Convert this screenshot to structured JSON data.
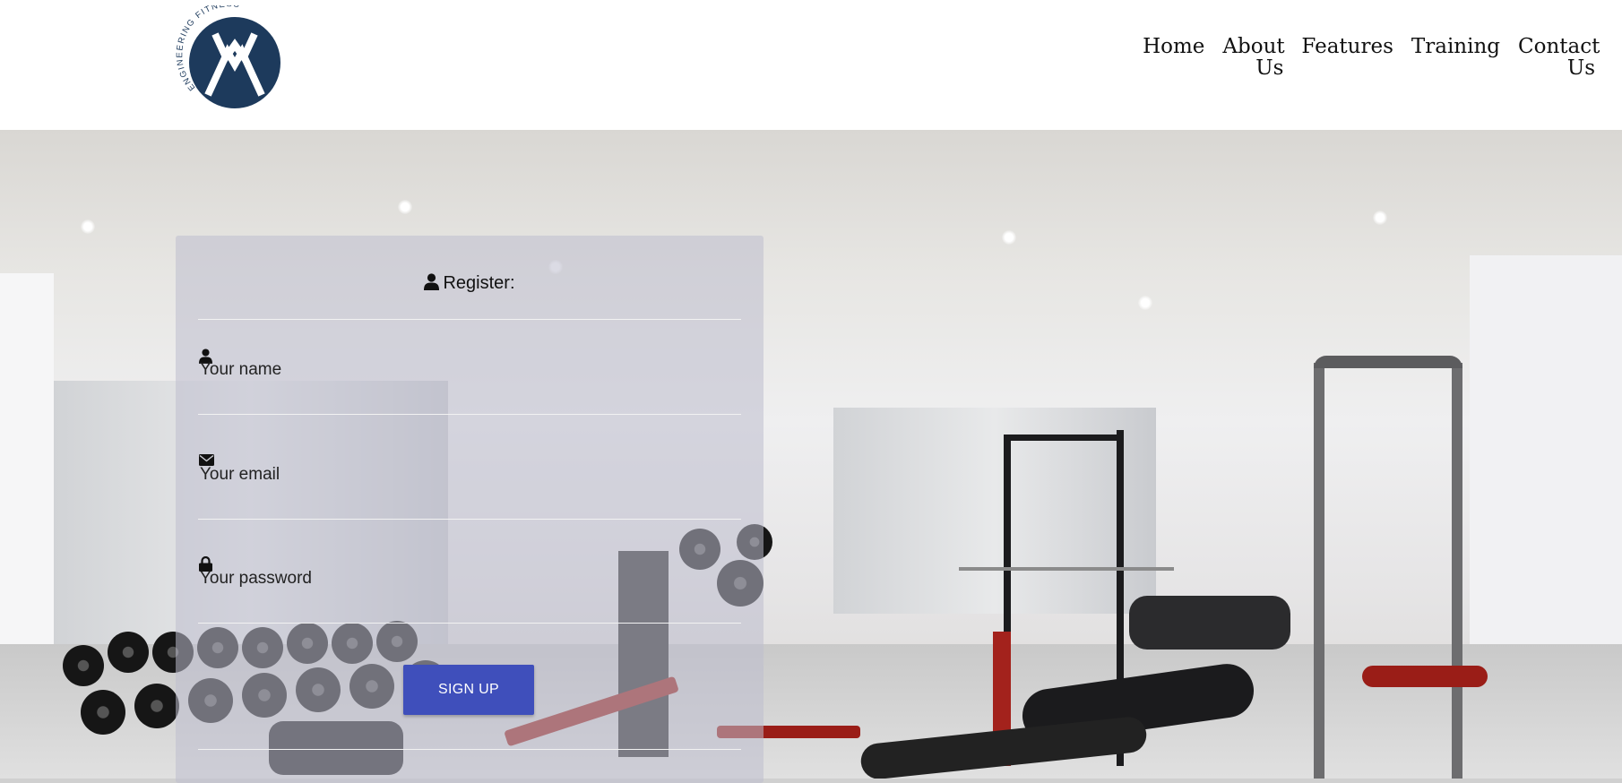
{
  "brand": {
    "logo_text": "ENGINEERING FITNESS"
  },
  "nav": {
    "items": [
      {
        "label": "Home"
      },
      {
        "label": "About Us"
      },
      {
        "label": "Features"
      },
      {
        "label": "Training"
      },
      {
        "label": "Contact Us"
      }
    ]
  },
  "register": {
    "title": "Register:",
    "name_placeholder": "Your name",
    "email_placeholder": "Your email",
    "password_placeholder": "Your password",
    "submit_label": "SIGN UP"
  },
  "colors": {
    "logo_navy": "#1d3a5c",
    "button_blue": "#3f4fbb"
  },
  "icons": [
    "user-icon",
    "envelope-icon",
    "lock-icon"
  ]
}
